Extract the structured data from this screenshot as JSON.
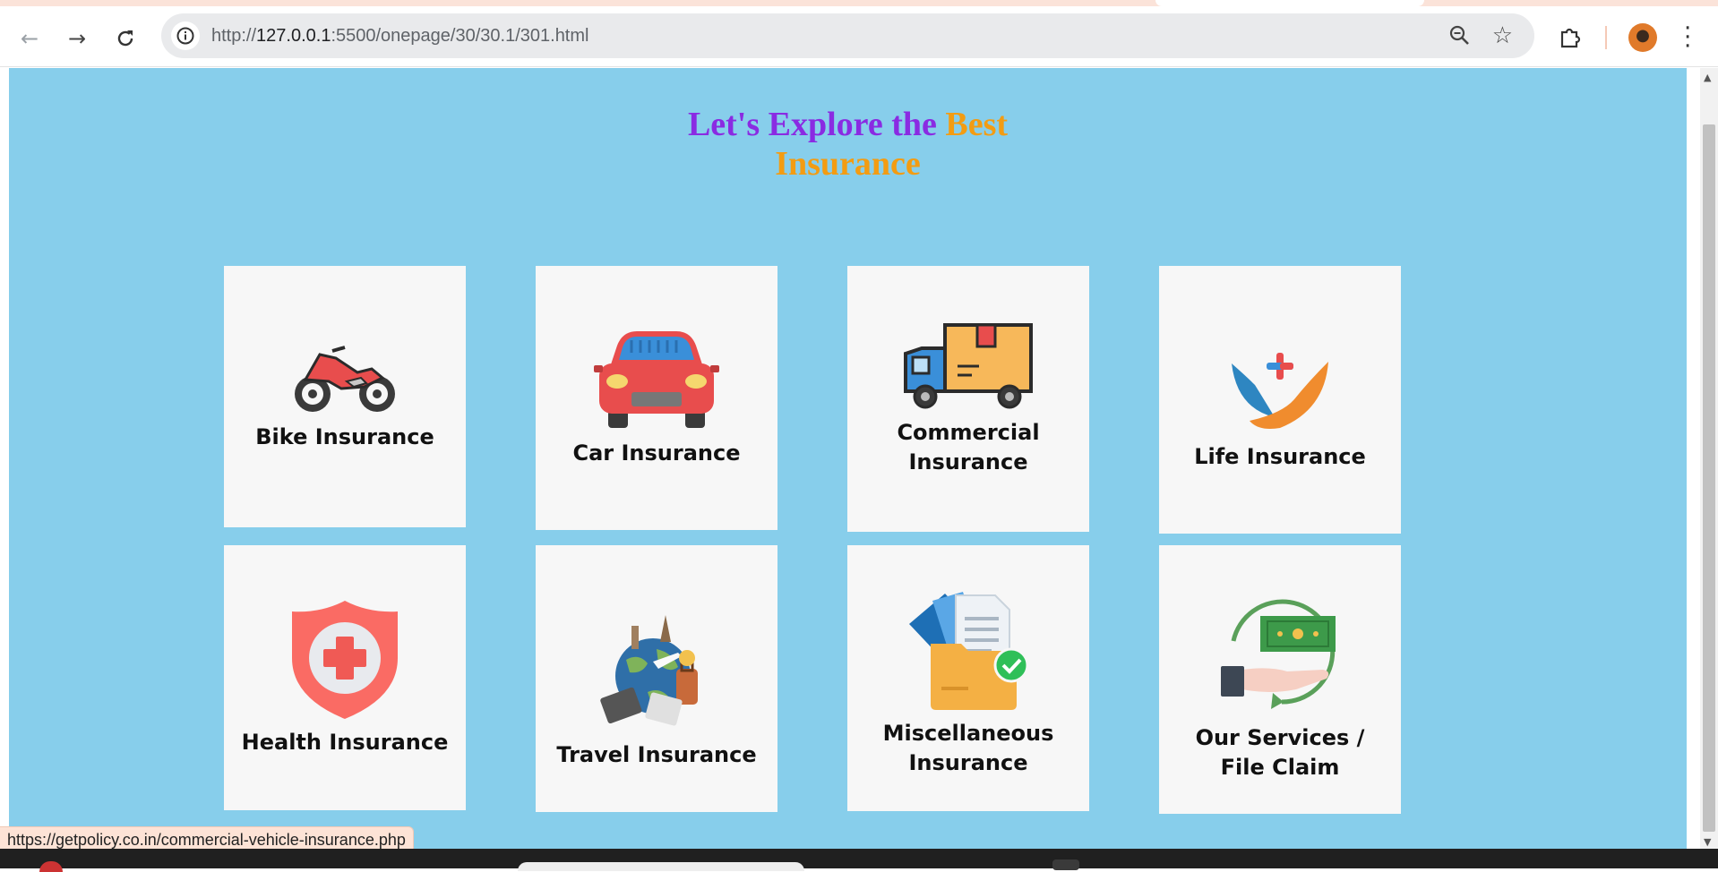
{
  "browser": {
    "url_prefix": "http://",
    "url_host": "127.0.0.1",
    "url_rest": ":5500/onepage/30/30.1/301.html",
    "status_url": "https://getpolicy.co.in/commercial-vehicle-insurance.php"
  },
  "page": {
    "heading_part1": "Let's Explore the ",
    "heading_part2": "Best",
    "heading_part3": "Insurance",
    "cards": [
      {
        "label": "Bike Insurance",
        "icon": "motorcycle-icon"
      },
      {
        "label": "Car Insurance",
        "icon": "car-icon"
      },
      {
        "label": "Commercial Insurance",
        "icon": "delivery-truck-icon"
      },
      {
        "label": "Life Insurance",
        "icon": "hands-cross-icon"
      },
      {
        "label": "Health Insurance",
        "icon": "medical-shield-icon"
      },
      {
        "label": "Travel Insurance",
        "icon": "globe-travel-icon"
      },
      {
        "label": "Miscellaneous Insurance",
        "icon": "folder-check-icon"
      },
      {
        "label": "Our Services / File Claim",
        "icon": "money-hand-icon"
      }
    ]
  },
  "colors": {
    "background": "#87ceeb",
    "heading_purple": "#8a2be2",
    "heading_orange": "#f39c12",
    "card": "#f7f7f7"
  }
}
